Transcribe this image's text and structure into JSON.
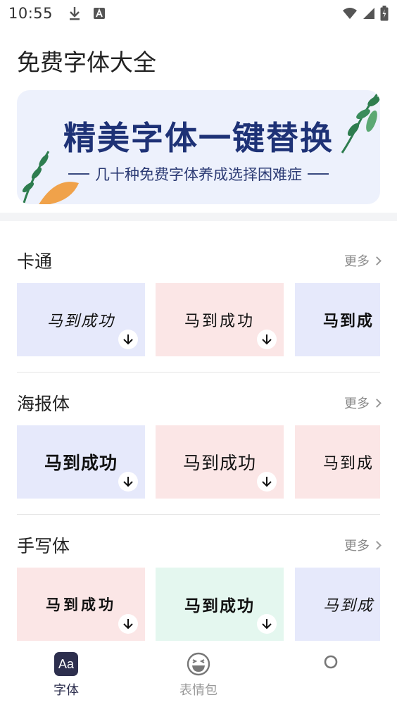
{
  "status_bar": {
    "time": "10:55",
    "icons_left": [
      "download-icon",
      "text-a-icon"
    ],
    "icons_right": [
      "wifi-icon",
      "signal-icon",
      "battery-charging-icon"
    ]
  },
  "app_title": "免费字体大全",
  "banner": {
    "headline": "精美字体一键替换",
    "subtitle": "几十种免费字体养成选择困难症",
    "background": "#edf1fc",
    "headline_color": "#1e3276"
  },
  "sections": [
    {
      "title": "卡通",
      "more_label": "更多",
      "cards": [
        {
          "text": "马到成功",
          "color": "#e6e9fb"
        },
        {
          "text": "马到成功",
          "color": "#fbe6e6"
        },
        {
          "text": "马到成",
          "color": "#e6e9fb"
        }
      ]
    },
    {
      "title": "海报体",
      "more_label": "更多",
      "cards": [
        {
          "text": "马到成功",
          "color": "#e6e9fb"
        },
        {
          "text": "马到成功",
          "color": "#fbe6e6"
        },
        {
          "text": "马到成",
          "color": "#fbe6e6"
        }
      ]
    },
    {
      "title": "手写体",
      "more_label": "更多",
      "cards": [
        {
          "text": "马到成功",
          "color": "#fbe6e6"
        },
        {
          "text": "马到成功",
          "color": "#e4f7ef"
        },
        {
          "text": "马到成",
          "color": "#e6e9fb"
        }
      ]
    }
  ],
  "bottom_nav": {
    "items": [
      {
        "label": "字体",
        "icon": "font-aa-icon",
        "icon_text": "Aa",
        "active": true
      },
      {
        "label": "表情包",
        "icon": "laughing-face-icon",
        "active": false
      },
      {
        "label": "",
        "icon": "circle-icon",
        "active": false
      }
    ],
    "active_color": "#2d2f4e",
    "inactive_color": "#999999"
  }
}
